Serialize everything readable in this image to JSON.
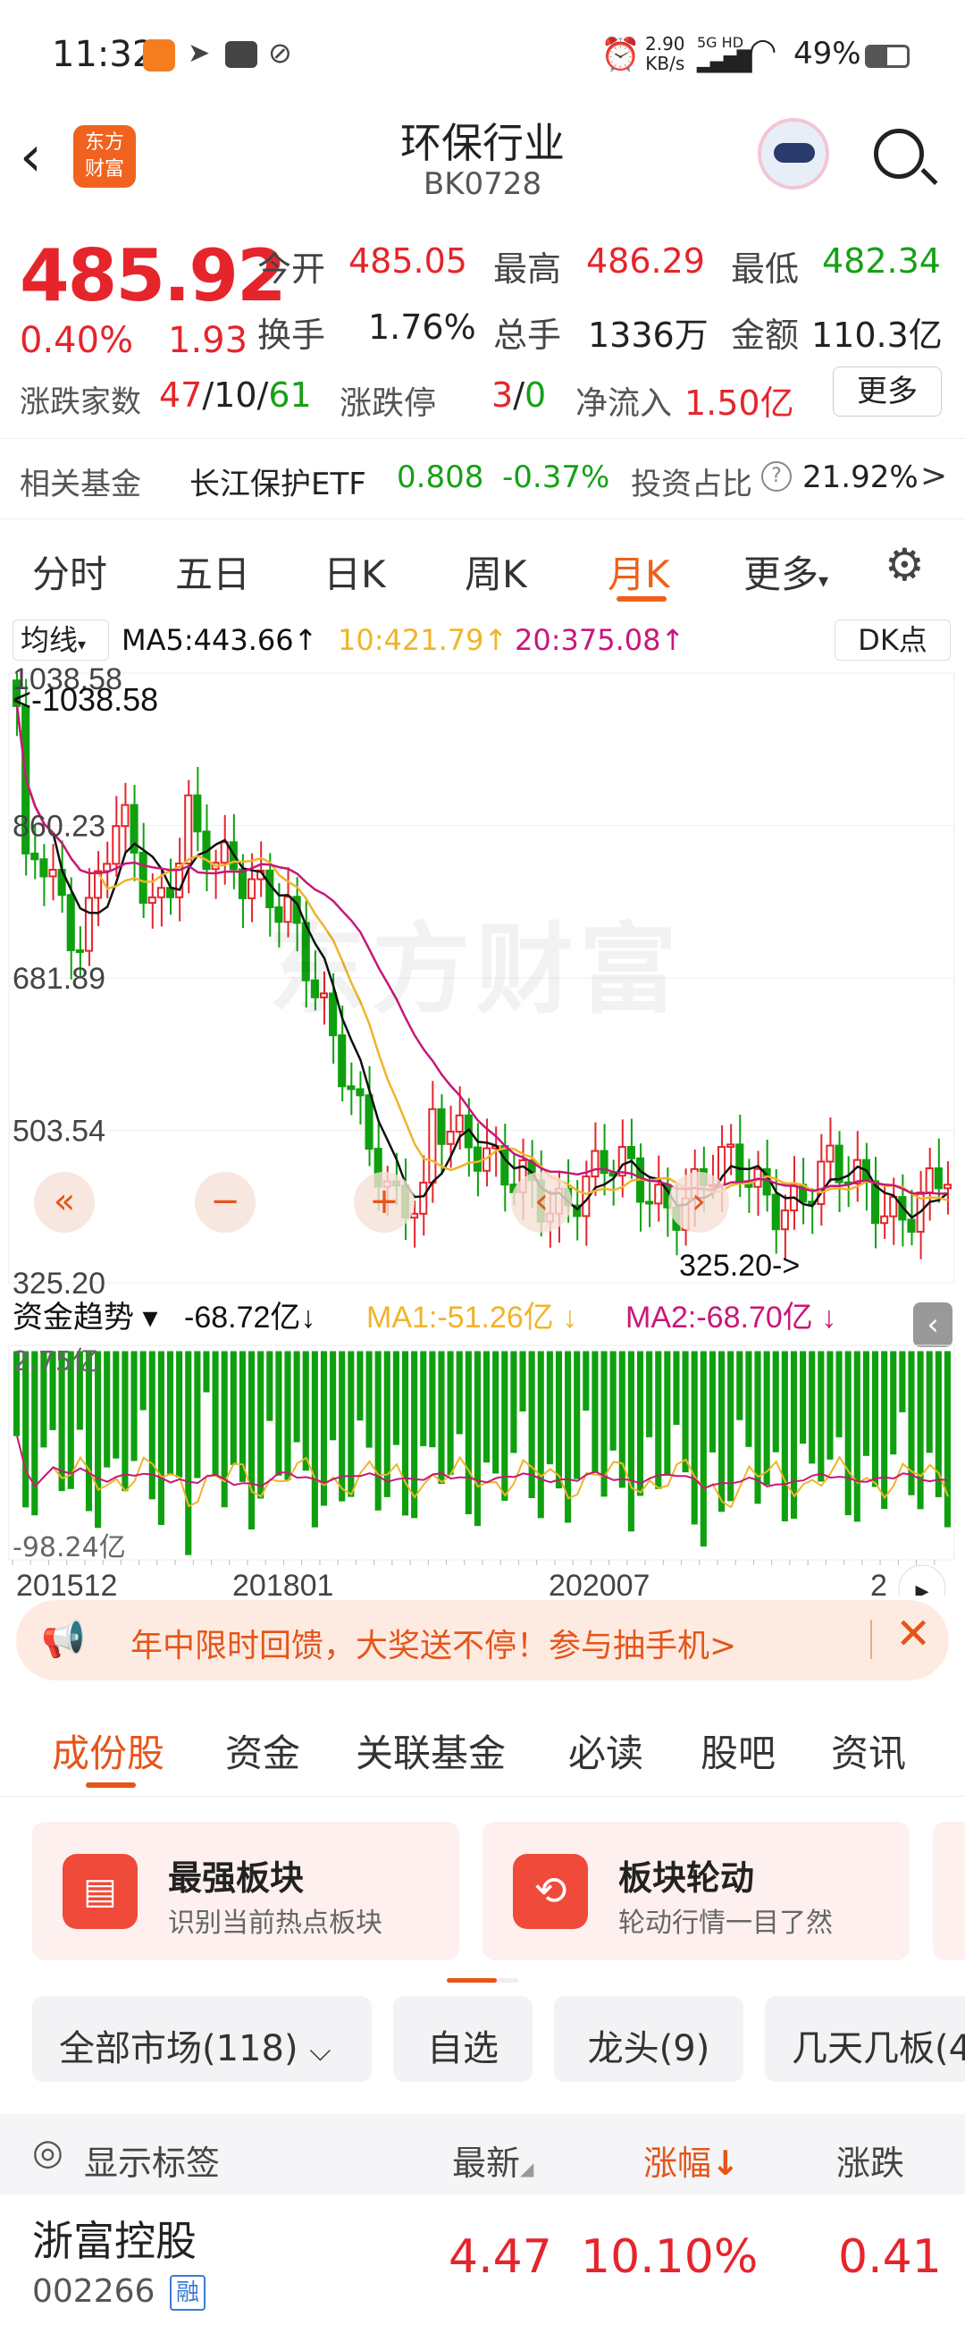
{
  "status": {
    "time": "11:32",
    "speed_top": "2.90",
    "speed_bottom": "KB/s",
    "net_top": "5G HD",
    "battery": "49%"
  },
  "header": {
    "title": "环保行业",
    "code": "BK0728",
    "logo_line1": "东方",
    "logo_line2": "财富"
  },
  "quote": {
    "price": "485.92",
    "pct": "0.40%",
    "chg": "1.93",
    "open_label": "今开",
    "open": "485.05",
    "high_label": "最高",
    "high": "486.29",
    "low_label": "最低",
    "low": "482.34",
    "turnover_label": "换手",
    "turnover": "1.76%",
    "volume_label": "总手",
    "volume": "1336万",
    "amount_label": "金额",
    "amount": "110.3亿",
    "updown_label": "涨跌家数",
    "up": "47",
    "flat": "10",
    "down": "61",
    "sep": "/",
    "limit_label": "涨跌停",
    "limit_up": "3",
    "limit_down": "0",
    "inflow_label": "净流入",
    "inflow": "1.50亿",
    "more": "更多",
    "fund_label": "相关基金",
    "fund_name": "长江保护ETF",
    "fund_price": "0.808",
    "fund_pct": "-0.37%",
    "ratio_label": "投资占比",
    "ratio": "21.92%",
    "ratio_arrow": ">"
  },
  "tabs": [
    "分时",
    "五日",
    "日K",
    "周K",
    "月K",
    "更多"
  ],
  "chart": {
    "ma_label": "均线",
    "ma5": "MA5:443.66",
    "ma10": "10:421.79",
    "ma20": "20:375.08",
    "arrow": "↑",
    "dk": "DK点",
    "y_ticks": [
      "1038.58",
      "860.23",
      "681.89",
      "503.54",
      "325.20"
    ],
    "max_label": "<-1038.58",
    "min_label": "325.20->",
    "watermark": "东方财富",
    "flow_label": "资金趋势",
    "flow_val": "-68.72亿",
    "flow_ma1": "MA1:-51.26亿",
    "flow_ma2": "MA2:-68.70亿",
    "down_arrow": "↓",
    "flow_top": "2.75亿",
    "flow_bottom": "-98.24亿",
    "x_ticks": [
      "201512",
      "201801",
      "202007",
      "2"
    ],
    "colors": {
      "up": "#e5252b",
      "down": "#0fa00f",
      "ma5": "#111111",
      "ma10": "#f0b429",
      "ma20": "#c8177a"
    }
  },
  "banner": {
    "text": "年中限时回馈，大奖送不停！参与抽手机>"
  },
  "subtabs": [
    "成份股",
    "资金",
    "关联基金",
    "必读",
    "股吧",
    "资讯"
  ],
  "cards": [
    {
      "title": "最强板块",
      "sub": "识别当前热点板块"
    },
    {
      "title": "板块轮动",
      "sub": "轮动行情一目了然"
    }
  ],
  "filters": [
    "全部市场(118)",
    "自选",
    "龙头(9)",
    "几天几板(4"
  ],
  "table": {
    "show_tags": "显示标签",
    "col_latest": "最新",
    "col_pct": "涨幅",
    "col_chg": "涨跌",
    "pct_arrow": "↓"
  },
  "rows": [
    {
      "name": "浙富控股",
      "code": "002266",
      "tag": "融",
      "latest": "4.47",
      "pct": "10.10%",
      "chg": "0.41"
    }
  ]
}
